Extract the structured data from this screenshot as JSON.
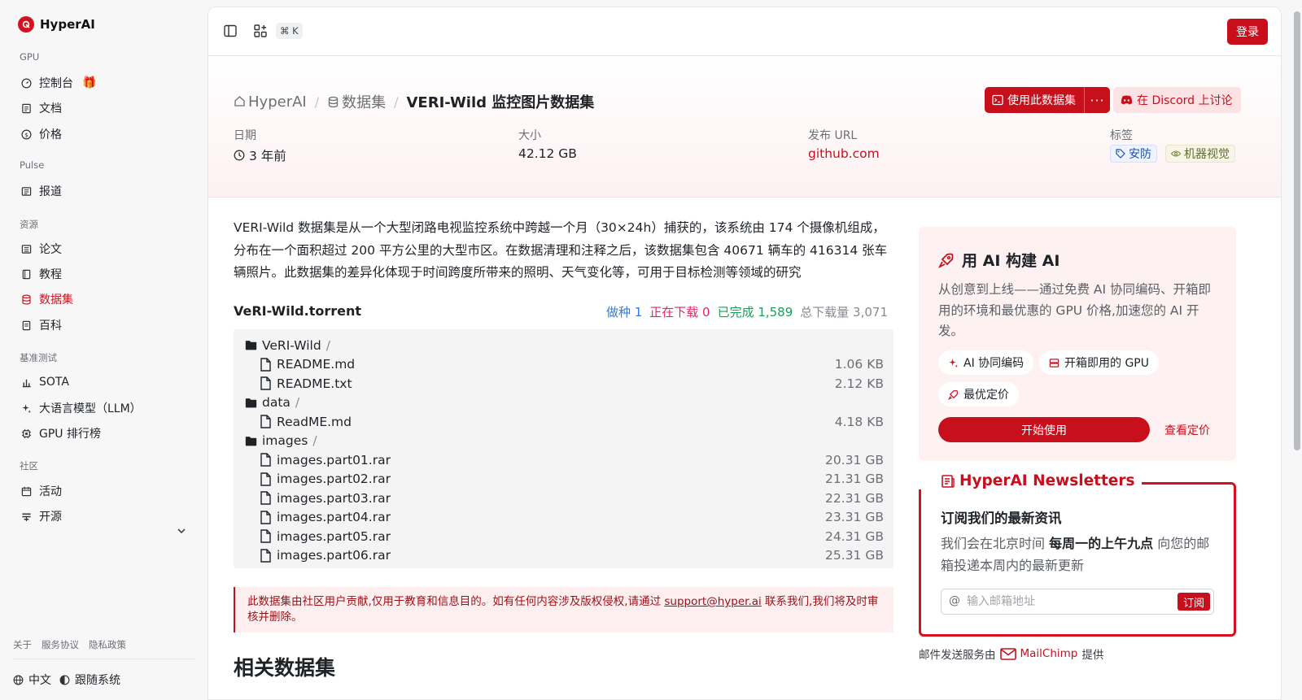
{
  "brand": {
    "name": "HyperAI"
  },
  "sidebar": {
    "sections": [
      {
        "title": "GPU"
      },
      {
        "title": "Pulse"
      },
      {
        "title": "资源"
      },
      {
        "title": "基准测试"
      },
      {
        "title": "社区"
      }
    ],
    "items": [
      {
        "label": "控制台",
        "icon": "dashboard-icon"
      },
      {
        "label": "文档",
        "icon": "doc-icon"
      },
      {
        "label": "价格",
        "icon": "dollar-icon"
      },
      {
        "label": "报道",
        "icon": "newspaper-icon"
      },
      {
        "label": "论文",
        "icon": "paper-icon"
      },
      {
        "label": "教程",
        "icon": "book-icon"
      },
      {
        "label": "数据集",
        "icon": "database-icon",
        "active": true
      },
      {
        "label": "百科",
        "icon": "wiki-icon"
      },
      {
        "label": "SOTA",
        "icon": "chart-icon"
      },
      {
        "label": "大语言模型（LLM）",
        "icon": "sparkle-icon"
      },
      {
        "label": "GPU 排行榜",
        "icon": "chip-icon"
      },
      {
        "label": "活动",
        "icon": "calendar-icon"
      },
      {
        "label": "开源",
        "icon": "menu-icon"
      }
    ],
    "footer_links": [
      "关于",
      "服务协议",
      "隐私政策"
    ],
    "language": "中文",
    "theme": "跟随系统"
  },
  "topbar": {
    "shortcut": "⌘ K",
    "login": "登录"
  },
  "breadcrumb": {
    "home": "HyperAI",
    "section": "数据集",
    "current": "VERI-Wild 监控图片数据集"
  },
  "actions": {
    "use_dataset": "使用此数据集",
    "more": "···",
    "discord": "在 Discord 上讨论"
  },
  "meta": {
    "date_label": "日期",
    "date_value": "3 年前",
    "size_label": "大小",
    "size_value": "42.12 GB",
    "url_label": "发布 URL",
    "url_value": "github.com",
    "tags_label": "标签",
    "tags": [
      "安防",
      "机器视觉"
    ]
  },
  "description": "VERI-Wild 数据集是从一个大型闭路电视监控系统中跨越一个月（30×24h）捕获的，该系统由 174 个摄像机组成，分布在一个面积超过 200 平方公里的大型市区。在数据清理和注释之后，该数据集包含 40671 辆车的 416314 张车辆照片。此数据集的差异化体现于时间跨度所带来的照明、天气变化等，可用于目标检测等领域的研究",
  "torrent": {
    "title": "VeRI-Wild.torrent",
    "seeding": "做种 1",
    "downloading": "正在下载 0",
    "completed": "已完成 1,589",
    "total": "总下载量 3,071",
    "rows": [
      {
        "type": "dir",
        "name": "VeRI-Wild",
        "size": ""
      },
      {
        "type": "file",
        "name": "README.md",
        "size": "1.06 KB"
      },
      {
        "type": "file",
        "name": "README.txt",
        "size": "2.12 KB"
      },
      {
        "type": "dir",
        "name": "data",
        "size": ""
      },
      {
        "type": "file",
        "name": "ReadME.md",
        "size": "4.18 KB"
      },
      {
        "type": "dir",
        "name": "images",
        "size": ""
      },
      {
        "type": "file",
        "name": "images.part01.rar",
        "size": "20.31 GB"
      },
      {
        "type": "file",
        "name": "images.part02.rar",
        "size": "21.31 GB"
      },
      {
        "type": "file",
        "name": "images.part03.rar",
        "size": "22.31 GB"
      },
      {
        "type": "file",
        "name": "images.part04.rar",
        "size": "23.31 GB"
      },
      {
        "type": "file",
        "name": "images.part05.rar",
        "size": "24.31 GB"
      },
      {
        "type": "file",
        "name": "images.part06.rar",
        "size": "25.31 GB"
      }
    ]
  },
  "notice": {
    "before": "此数据集由社区用户贡献,仅用于教育和信息目的。如有任何内容涉及版权侵权,请通过 ",
    "email": "support@hyper.ai",
    "after": " 联系我们,我们将及时审核并删除。"
  },
  "related_title": "相关数据集",
  "ai_card": {
    "title": "用 AI 构建 AI",
    "desc": "从创意到上线——通过免费 AI 协同编码、开箱即用的环境和最优惠的 GPU 价格,加速您的 AI 开发。",
    "chips": [
      "AI 协同编码",
      "开箱即用的 GPU",
      "最优定价"
    ],
    "start": "开始使用",
    "pricing": "查看定价"
  },
  "newsletter": {
    "heading": "HyperAI Newsletters",
    "title": "订阅我们的最新资讯",
    "desc_pre": "我们会在北京时间 ",
    "desc_bold": "每周一的上午九点",
    "desc_post": " 向您的邮箱投递本周内的最新更新",
    "placeholder": "输入邮箱地址",
    "subscribe": "订阅",
    "provider_pre": "邮件发送服务由",
    "provider": "MailChimp",
    "provider_post": "提供"
  },
  "colors": {
    "accent": "#c8101c",
    "seed": "#2f7be6",
    "downloading": "#e5245d",
    "completed": "#18a058"
  }
}
